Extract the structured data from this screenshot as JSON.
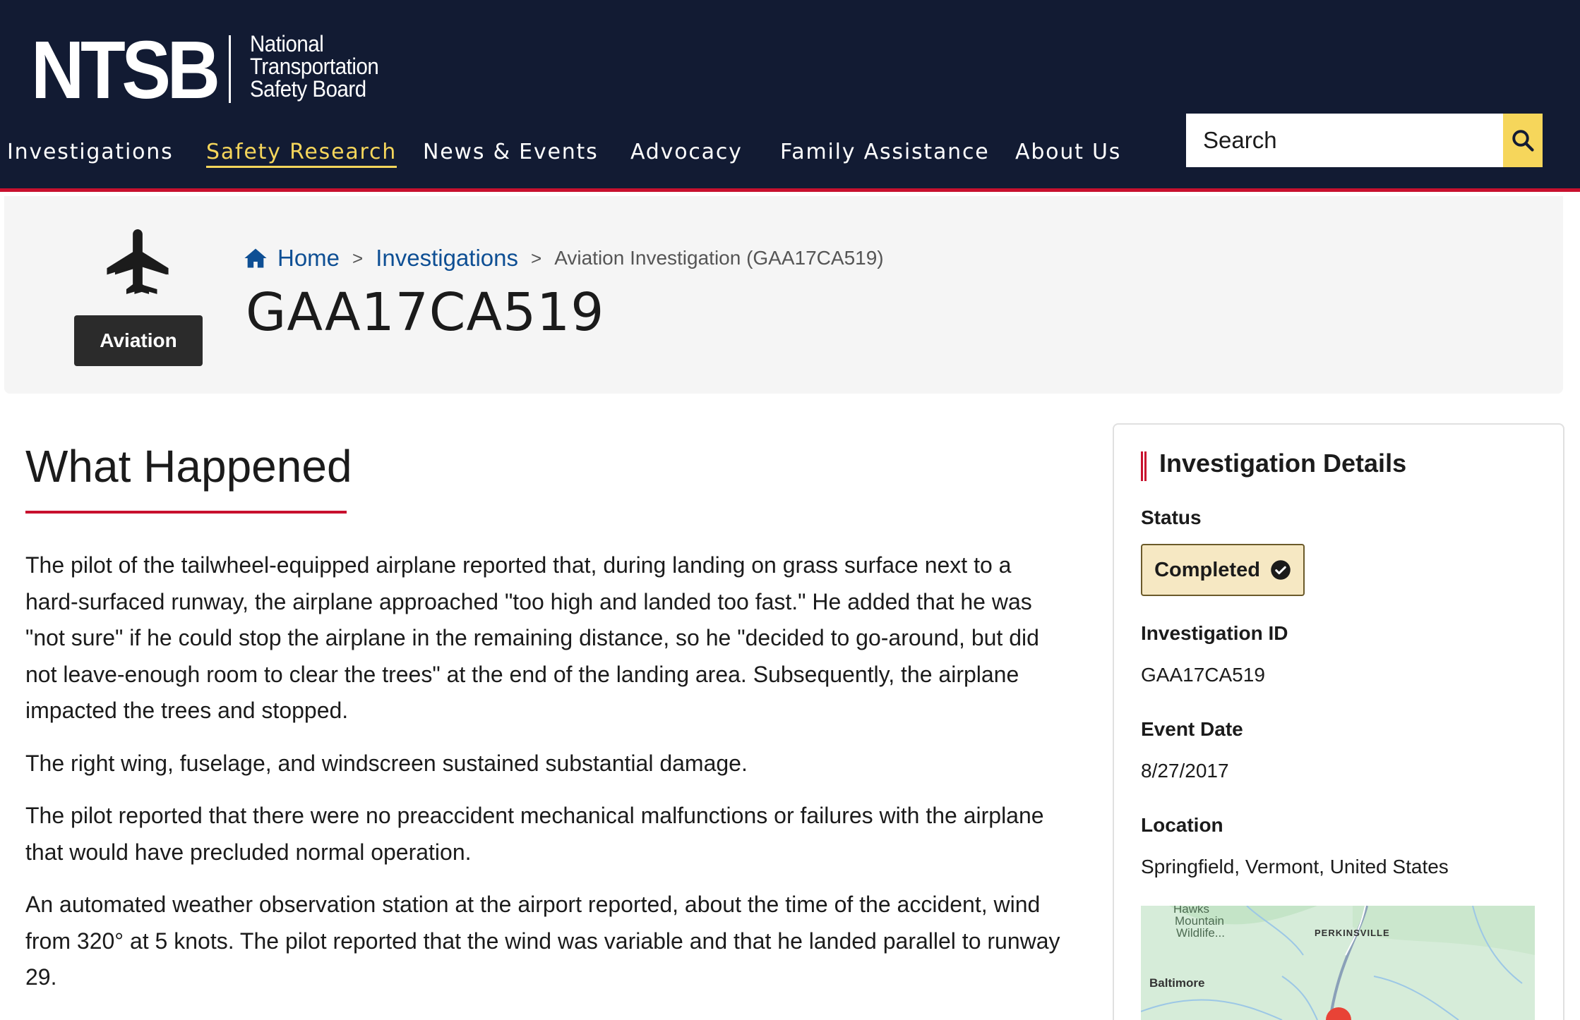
{
  "header": {
    "logo": {
      "acronym": "NTSB",
      "line1": "National",
      "line2": "Transportation",
      "line3": "Safety Board"
    },
    "nav": [
      {
        "label": "Investigations",
        "active": false
      },
      {
        "label": "Safety Research",
        "active": true
      },
      {
        "label": "News & Events",
        "active": false
      },
      {
        "label": "Advocacy",
        "active": false
      },
      {
        "label": "Family Assistance",
        "active": false
      },
      {
        "label": "About Us",
        "active": false
      }
    ],
    "search": {
      "placeholder": "Search",
      "icon": "search-icon"
    }
  },
  "hero": {
    "mode_icon": "airplane-icon",
    "mode_label": "Aviation",
    "breadcrumb": {
      "home": "Home",
      "sep": ">",
      "investigations": "Investigations",
      "current": "Aviation Investigation (GAA17CA519)"
    },
    "title": "GAA17CA519"
  },
  "main": {
    "heading": "What Happened",
    "paragraphs": [
      "The pilot of the tailwheel-equipped airplane reported that, during landing on grass surface next to a hard-surfaced runway, the airplane approached \"too high and landed too fast.\" He added that he was \"not sure\" if he could stop the airplane in the remaining distance, so he \"decided to go-around, but did not leave-enough room to clear the trees\" at the end of the landing area. Subsequently, the airplane impacted the trees and stopped.",
      "The right wing, fuselage, and windscreen sustained substantial damage.",
      "The pilot reported that there were no preaccident mechanical malfunctions or failures with the airplane that would have precluded normal operation.",
      "An automated weather observation station at the airport reported, about the time of the accident, wind from 320° at 5 knots. The pilot reported that the wind was variable and that he landed parallel to runway 29."
    ]
  },
  "details": {
    "title": "Investigation Details",
    "status_label": "Status",
    "status_value": "Completed",
    "status_icon": "check-circle-icon",
    "id_label": "Investigation ID",
    "id_value": "GAA17CA519",
    "date_label": "Event Date",
    "date_value": "8/27/2017",
    "location_label": "Location",
    "location_value": "Springfield, Vermont, United States",
    "map": {
      "labels": [
        "Hawks",
        "Mountain",
        "Wildlife...",
        "PERKINSVILLE",
        "Baltimore"
      ]
    }
  },
  "colors": {
    "header_bg": "#121b33",
    "accent_red": "#c8102e",
    "accent_yellow": "#f6d65b",
    "link_blue": "#0e4f94",
    "status_bg": "#f6e8c3"
  }
}
